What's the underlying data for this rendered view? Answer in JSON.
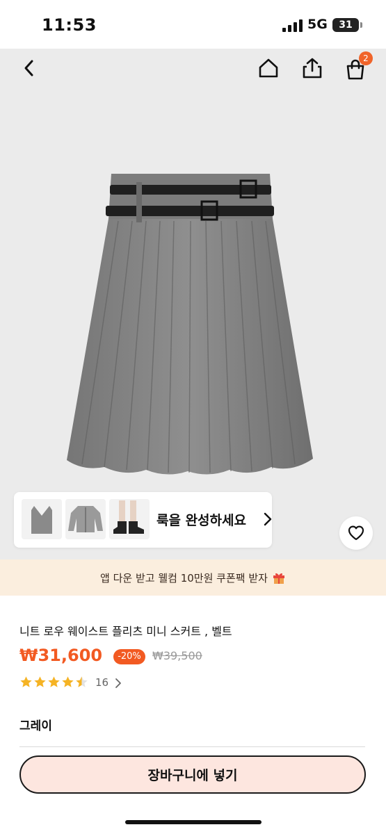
{
  "status_bar": {
    "time": "11:53",
    "network": "5G",
    "battery": "31"
  },
  "header": {
    "cart_badge": "2"
  },
  "outfit": {
    "label": "룩을 완성하세요"
  },
  "promo": {
    "text": "앱 다운 받고 웰컴 10만원 쿠폰팩 받자"
  },
  "product": {
    "title": "니트 로우 웨이스트 플리츠 미니 스커트 , 벨트",
    "price": "₩31,600",
    "discount": "-20%",
    "original_price": "₩39,500",
    "rating": 4.5,
    "review_count": "16",
    "color": "그레이"
  },
  "actions": {
    "add_to_cart": "장바구니에 넣기"
  },
  "colors": {
    "accent": "#f25a22",
    "promo_bg": "#fbeede",
    "button_bg": "#fde6df"
  }
}
